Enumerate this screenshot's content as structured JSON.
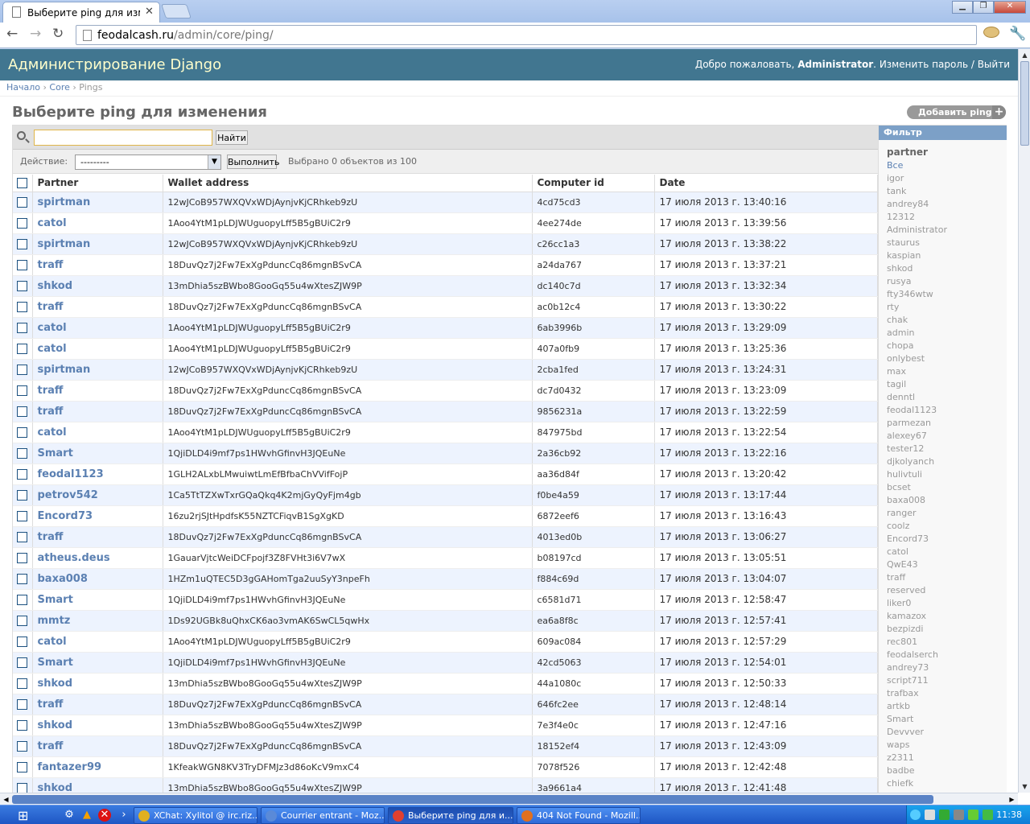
{
  "browser": {
    "tab_title": "Выберите ping для измене",
    "url_host": "feodalcash.ru",
    "url_path": "/admin/core/ping/"
  },
  "header": {
    "site_name": "Администрирование Django",
    "welcome": "Добро пожаловать,",
    "user": "Administrator",
    "change_password": "Изменить пароль",
    "sep": " / ",
    "logout": "Выйти"
  },
  "breadcrumbs": {
    "home": "Начало",
    "app": "Core",
    "model": "Pings",
    "sep": " › "
  },
  "title": "Выберите ping для изменения",
  "add_button": "Добавить ping",
  "search": {
    "button": "Найти",
    "value": ""
  },
  "actions": {
    "label": "Действие:",
    "selected": "---------",
    "go": "Выполнить",
    "counter": "Выбрано 0 объектов из 100"
  },
  "columns": [
    "Partner",
    "Wallet address",
    "Computer id",
    "Date"
  ],
  "rows": [
    {
      "partner": "spirtman",
      "wallet": "12wJCoB957WXQVxWDjAynjvKjCRhkeb9zU",
      "cid": "4cd75cd3",
      "date": "17 июля 2013 г. 13:40:16"
    },
    {
      "partner": "catol",
      "wallet": "1Aoo4YtM1pLDJWUguopyLff5B5gBUiC2r9",
      "cid": "4ee274de",
      "date": "17 июля 2013 г. 13:39:56"
    },
    {
      "partner": "spirtman",
      "wallet": "12wJCoB957WXQVxWDjAynjvKjCRhkeb9zU",
      "cid": "c26cc1a3",
      "date": "17 июля 2013 г. 13:38:22"
    },
    {
      "partner": "traff",
      "wallet": "18DuvQz7j2Fw7ExXgPduncCq86mgnBSvCA",
      "cid": "a24da767",
      "date": "17 июля 2013 г. 13:37:21"
    },
    {
      "partner": "shkod",
      "wallet": "13mDhia5szBWbo8GooGq55u4wXtesZJW9P",
      "cid": "dc140c7d",
      "date": "17 июля 2013 г. 13:32:34"
    },
    {
      "partner": "traff",
      "wallet": "18DuvQz7j2Fw7ExXgPduncCq86mgnBSvCA",
      "cid": "ac0b12c4",
      "date": "17 июля 2013 г. 13:30:22"
    },
    {
      "partner": "catol",
      "wallet": "1Aoo4YtM1pLDJWUguopyLff5B5gBUiC2r9",
      "cid": "6ab3996b",
      "date": "17 июля 2013 г. 13:29:09"
    },
    {
      "partner": "catol",
      "wallet": "1Aoo4YtM1pLDJWUguopyLff5B5gBUiC2r9",
      "cid": "407a0fb9",
      "date": "17 июля 2013 г. 13:25:36"
    },
    {
      "partner": "spirtman",
      "wallet": "12wJCoB957WXQVxWDjAynjvKjCRhkeb9zU",
      "cid": "2cba1fed",
      "date": "17 июля 2013 г. 13:24:31"
    },
    {
      "partner": "traff",
      "wallet": "18DuvQz7j2Fw7ExXgPduncCq86mgnBSvCA",
      "cid": "dc7d0432",
      "date": "17 июля 2013 г. 13:23:09"
    },
    {
      "partner": "traff",
      "wallet": "18DuvQz7j2Fw7ExXgPduncCq86mgnBSvCA",
      "cid": "9856231a",
      "date": "17 июля 2013 г. 13:22:59"
    },
    {
      "partner": "catol",
      "wallet": "1Aoo4YtM1pLDJWUguopyLff5B5gBUiC2r9",
      "cid": "847975bd",
      "date": "17 июля 2013 г. 13:22:54"
    },
    {
      "partner": "Smart",
      "wallet": "1QjiDLD4i9mf7ps1HWvhGfinvH3JQEuNe",
      "cid": "2a36cb92",
      "date": "17 июля 2013 г. 13:22:16"
    },
    {
      "partner": "feodal1123",
      "wallet": "1GLH2ALxbLMwuiwtLmEfBfbaChVVifFojP",
      "cid": "aa36d84f",
      "date": "17 июля 2013 г. 13:20:42"
    },
    {
      "partner": "petrov542",
      "wallet": "1Ca5TtTZXwTxrGQaQkq4K2mjGyQyFjm4gb",
      "cid": "f0be4a59",
      "date": "17 июля 2013 г. 13:17:44"
    },
    {
      "partner": "Encord73",
      "wallet": "16zu2rjSJtHpdfsK55NZTCFiqvB1SgXgKD",
      "cid": "6872eef6",
      "date": "17 июля 2013 г. 13:16:43"
    },
    {
      "partner": "traff",
      "wallet": "18DuvQz7j2Fw7ExXgPduncCq86mgnBSvCA",
      "cid": "4013ed0b",
      "date": "17 июля 2013 г. 13:06:27"
    },
    {
      "partner": "atheus.deus",
      "wallet": "1GauarVjtcWeiDCFpojf3Z8FVHt3i6V7wX",
      "cid": "b08197cd",
      "date": "17 июля 2013 г. 13:05:51"
    },
    {
      "partner": "baxa008",
      "wallet": "1HZm1uQTEC5D3gGAHomTga2uuSyY3npeFh",
      "cid": "f884c69d",
      "date": "17 июля 2013 г. 13:04:07"
    },
    {
      "partner": "Smart",
      "wallet": "1QjiDLD4i9mf7ps1HWvhGfinvH3JQEuNe",
      "cid": "c6581d71",
      "date": "17 июля 2013 г. 12:58:47"
    },
    {
      "partner": "mmtz",
      "wallet": "1Ds92UGBk8uQhxCK6ao3vmAK6SwCL5qwHx",
      "cid": "ea6a8f8c",
      "date": "17 июля 2013 г. 12:57:41"
    },
    {
      "partner": "catol",
      "wallet": "1Aoo4YtM1pLDJWUguopyLff5B5gBUiC2r9",
      "cid": "609ac084",
      "date": "17 июля 2013 г. 12:57:29"
    },
    {
      "partner": "Smart",
      "wallet": "1QjiDLD4i9mf7ps1HWvhGfinvH3JQEuNe",
      "cid": "42cd5063",
      "date": "17 июля 2013 г. 12:54:01"
    },
    {
      "partner": "shkod",
      "wallet": "13mDhia5szBWbo8GooGq55u4wXtesZJW9P",
      "cid": "44a1080c",
      "date": "17 июля 2013 г. 12:50:33"
    },
    {
      "partner": "traff",
      "wallet": "18DuvQz7j2Fw7ExXgPduncCq86mgnBSvCA",
      "cid": "646fc2ee",
      "date": "17 июля 2013 г. 12:48:14"
    },
    {
      "partner": "shkod",
      "wallet": "13mDhia5szBWbo8GooGq55u4wXtesZJW9P",
      "cid": "7e3f4e0c",
      "date": "17 июля 2013 г. 12:47:16"
    },
    {
      "partner": "traff",
      "wallet": "18DuvQz7j2Fw7ExXgPduncCq86mgnBSvCA",
      "cid": "18152ef4",
      "date": "17 июля 2013 г. 12:43:09"
    },
    {
      "partner": "fantazer99",
      "wallet": "1KfeakWGN8KV3TryDFMJz3d86oKcV9mxC4",
      "cid": "7078f526",
      "date": "17 июля 2013 г. 12:42:48"
    },
    {
      "partner": "shkod",
      "wallet": "13mDhia5szBWbo8GooGq55u4wXtesZJW9P",
      "cid": "3a9661a4",
      "date": "17 июля 2013 г. 12:41:48"
    }
  ],
  "filter": {
    "title": "Фильтр",
    "subtitle": "partner",
    "items": [
      "Все",
      "igor",
      "tank",
      "andrey84",
      "12312",
      "Administrator",
      "staurus",
      "kaspian",
      "shkod",
      "rusya",
      "fty346wtw",
      "rty",
      "chak",
      "admin",
      "chopa",
      "onlybest",
      "max",
      "tagil",
      "denntl",
      "feodal1123",
      "parmezan",
      "alexey67",
      "tester12",
      "djkolyanch",
      "hulivtuli",
      "bcset",
      "baxa008",
      "ranger",
      "coolz",
      "Encord73",
      "catol",
      "QwE43",
      "traff",
      "reserved",
      "liker0",
      "kamazox",
      "bezpizdi",
      "rec801",
      "feodalserch",
      "andrey73",
      "script711",
      "trafbax",
      "artkb",
      "Smart",
      "Devvver",
      "waps",
      "z2311",
      "badbe",
      "chiefk"
    ]
  },
  "taskbar": {
    "tasks": [
      "XChat: Xylitol @ irc.riz...",
      "Courrier entrant - Moz...",
      "Выберите ping для и...",
      "404 Not Found - Mozill..."
    ],
    "clock": "11:38"
  }
}
